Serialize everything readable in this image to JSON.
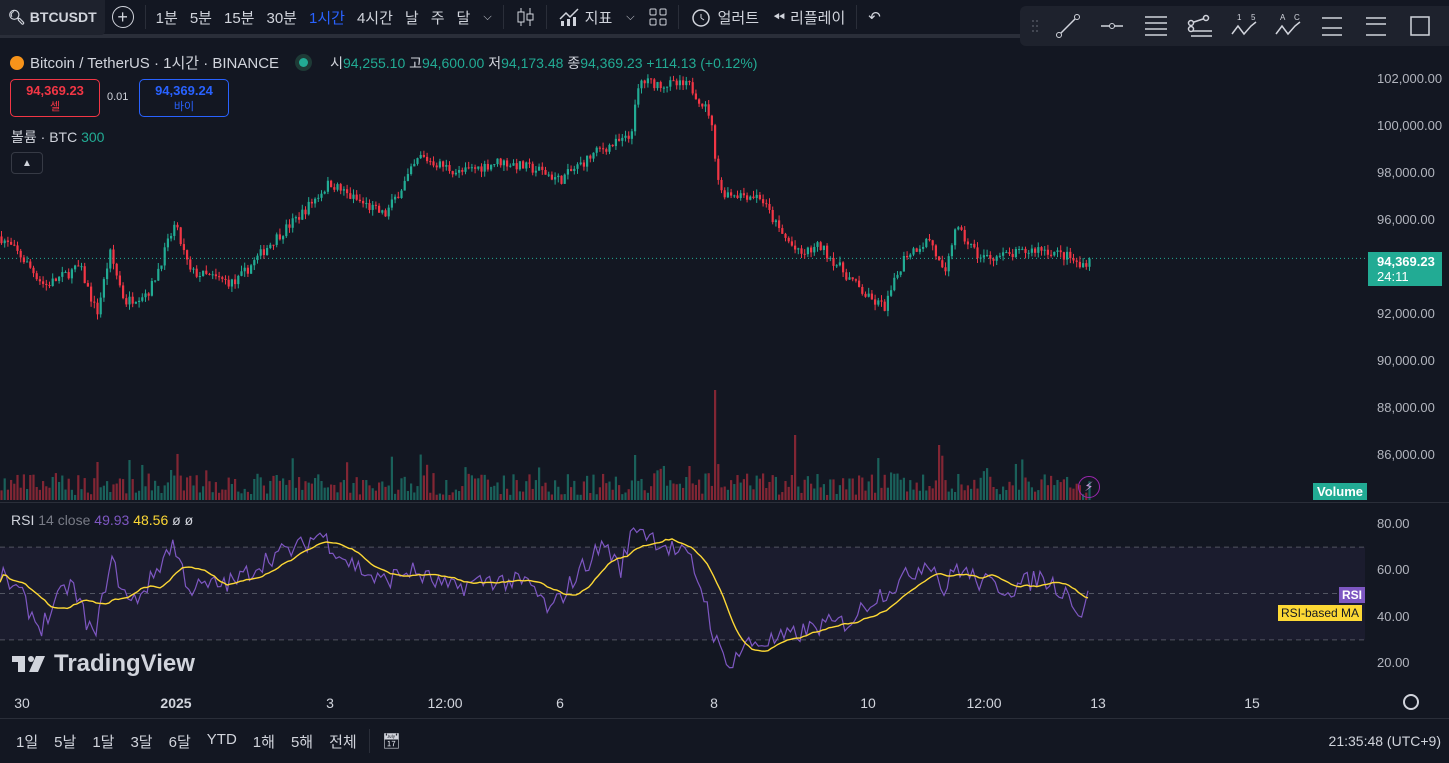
{
  "toolbar": {
    "symbol": "BTCUSDT",
    "intervals": [
      "1분",
      "5분",
      "15분",
      "30분",
      "1시간",
      "4시간",
      "날",
      "주",
      "달"
    ],
    "active_interval": "1시간",
    "indicators_label": "지표",
    "alert_label": "얼러트",
    "replay_label": "리플레이"
  },
  "legend": {
    "title": "Bitcoin / TetherUS · 1시간 · BINANCE",
    "o_label": "시",
    "o": "94,255.10",
    "h_label": "고",
    "h": "94,600.00",
    "l_label": "저",
    "l": "94,173.48",
    "c_label": "종",
    "c": "94,369.23",
    "change": "+114.13 (+0.12%)"
  },
  "trade": {
    "sell_price": "94,369.23",
    "sell_label": "셀",
    "spread": "0.01",
    "buy_price": "94,369.24",
    "buy_label": "바이"
  },
  "volume_legend": {
    "label": "볼륨 · BTC",
    "value": "300"
  },
  "price_axis": {
    "ticks": [
      "102,000.00",
      "100,000.00",
      "98,000.00",
      "96,000.00",
      "92,000.00",
      "90,000.00",
      "88,000.00",
      "86,000.00"
    ],
    "current_price": "94,369.23",
    "countdown": "24:11",
    "volume_tag": "Volume"
  },
  "rsi": {
    "label": "RSI",
    "params": "14 close",
    "value": "49.93",
    "ma_value": "48.56",
    "extra1": "ø",
    "extra2": "ø",
    "ticks": [
      "80.00",
      "60.00",
      "40.00",
      "20.00"
    ],
    "tag": "RSI",
    "ma_tag": "RSI-based MA"
  },
  "time_axis": {
    "labels": [
      "30",
      "2025",
      "3",
      "12:00",
      "6",
      "8",
      "10",
      "12:00",
      "13",
      "15"
    ]
  },
  "ranges": [
    "1일",
    "5날",
    "1달",
    "3달",
    "6달",
    "YTD",
    "1해",
    "5해",
    "전체"
  ],
  "clock": "21:35:48 (UTC+9)",
  "logo": "TradingView",
  "colors": {
    "up": "#22ab94",
    "down": "#f23645",
    "rsi": "#7e57c2",
    "rsi_ma": "#fdd835",
    "accent": "#2962ff"
  },
  "chart_data": {
    "type": "candlestick",
    "interval": "1h",
    "symbol": "BTCUSDT",
    "price_path": [
      [
        0,
        95300
      ],
      [
        20,
        94500
      ],
      [
        45,
        93200
      ],
      [
        80,
        94000
      ],
      [
        97,
        92000
      ],
      [
        110,
        94600
      ],
      [
        125,
        92500
      ],
      [
        150,
        93000
      ],
      [
        175,
        95800
      ],
      [
        190,
        93800
      ],
      [
        235,
        93300
      ],
      [
        270,
        95000
      ],
      [
        300,
        96200
      ],
      [
        330,
        97600
      ],
      [
        350,
        97000
      ],
      [
        385,
        96200
      ],
      [
        420,
        98700
      ],
      [
        460,
        98000
      ],
      [
        500,
        98500
      ],
      [
        540,
        98100
      ],
      [
        560,
        97700
      ],
      [
        600,
        99000
      ],
      [
        630,
        99500
      ],
      [
        640,
        101900
      ],
      [
        660,
        101800
      ],
      [
        690,
        101700
      ],
      [
        710,
        100500
      ],
      [
        720,
        97200
      ],
      [
        760,
        97000
      ],
      [
        780,
        95500
      ],
      [
        800,
        94500
      ],
      [
        820,
        94900
      ],
      [
        850,
        93500
      ],
      [
        870,
        92600
      ],
      [
        885,
        92300
      ],
      [
        905,
        94500
      ],
      [
        930,
        95200
      ],
      [
        945,
        93500
      ],
      [
        955,
        95700
      ],
      [
        980,
        94400
      ],
      [
        1010,
        94500
      ],
      [
        1040,
        94800
      ],
      [
        1070,
        94400
      ],
      [
        1080,
        94000
      ],
      [
        1090,
        94369
      ]
    ],
    "rsi_path": [
      [
        0,
        58
      ],
      [
        20,
        50
      ],
      [
        40,
        35
      ],
      [
        70,
        55
      ],
      [
        95,
        30
      ],
      [
        110,
        65
      ],
      [
        130,
        45
      ],
      [
        150,
        55
      ],
      [
        172,
        72
      ],
      [
        190,
        52
      ],
      [
        235,
        55
      ],
      [
        270,
        66
      ],
      [
        300,
        70
      ],
      [
        320,
        76
      ],
      [
        345,
        65
      ],
      [
        380,
        55
      ],
      [
        410,
        60
      ],
      [
        450,
        52
      ],
      [
        490,
        56
      ],
      [
        530,
        54
      ],
      [
        550,
        42
      ],
      [
        580,
        60
      ],
      [
        605,
        72
      ],
      [
        620,
        60
      ],
      [
        635,
        80
      ],
      [
        660,
        72
      ],
      [
        690,
        65
      ],
      [
        705,
        48
      ],
      [
        715,
        30
      ],
      [
        728,
        18
      ],
      [
        745,
        28
      ],
      [
        780,
        30
      ],
      [
        820,
        36
      ],
      [
        850,
        38
      ],
      [
        870,
        47
      ],
      [
        900,
        55
      ],
      [
        930,
        65
      ],
      [
        945,
        50
      ],
      [
        955,
        62
      ],
      [
        980,
        55
      ],
      [
        1010,
        52
      ],
      [
        1040,
        57
      ],
      [
        1070,
        50
      ],
      [
        1080,
        40
      ],
      [
        1090,
        49.93
      ]
    ],
    "price_range": [
      86000,
      102000
    ],
    "rsi_range": [
      20,
      80
    ]
  }
}
